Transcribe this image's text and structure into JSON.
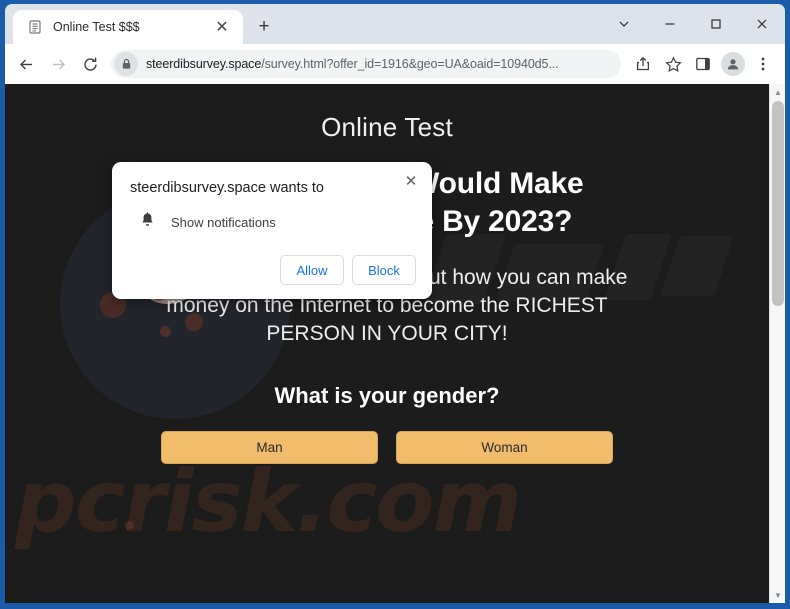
{
  "browser": {
    "tab": {
      "title": "Online Test $$$",
      "favicon": "document-icon",
      "close_label": "✕"
    },
    "new_tab_label": "+",
    "window_controls": {
      "search_tabs": "⌄",
      "minimize": "–",
      "maximize": "□",
      "close": "✕"
    },
    "toolbar": {
      "back": "←",
      "forward": "→",
      "reload": "↻",
      "lock_icon": "lock-icon",
      "url_main": "steerdibsurvey.space",
      "url_path": "/survey.html?offer_id=1916&geo=UA&oaid=10940d5...",
      "share_icon": "share-icon",
      "bookmark_icon": "star-icon",
      "sidepanel_icon": "side-panel-icon",
      "profile_icon": "profile-avatar-icon",
      "menu_icon": "three-dot-menu-icon"
    }
  },
  "permission_dialog": {
    "title": "steerdibsurvey.space wants to",
    "permission_icon": "bell-icon",
    "permission_label": "Show notifications",
    "allow_label": "Allow",
    "block_label": "Block",
    "close_label": "✕"
  },
  "page": {
    "site_title": "Online Test",
    "headline_line1": "What Business Would Make",
    "headline_line2": "You A Billionaire By 2023?",
    "subhead_line1": "Take this FREE test and find out how you can make",
    "subhead_line2": "money on the Internet to become the RICHEST",
    "subhead_line3": "PERSON IN YOUR CITY!",
    "question": "What is your gender?",
    "answers": [
      {
        "label": "Man"
      },
      {
        "label": "Woman"
      }
    ],
    "watermark": "pcrisk.com"
  },
  "scrollbar": {
    "up_arrow": "▲",
    "down_arrow": "▼"
  },
  "colors": {
    "window_frame": "#1b5ca8",
    "page_background": "#1c1c1c",
    "answer_button": "#f2bc6d",
    "link_blue": "#1a73e8"
  }
}
